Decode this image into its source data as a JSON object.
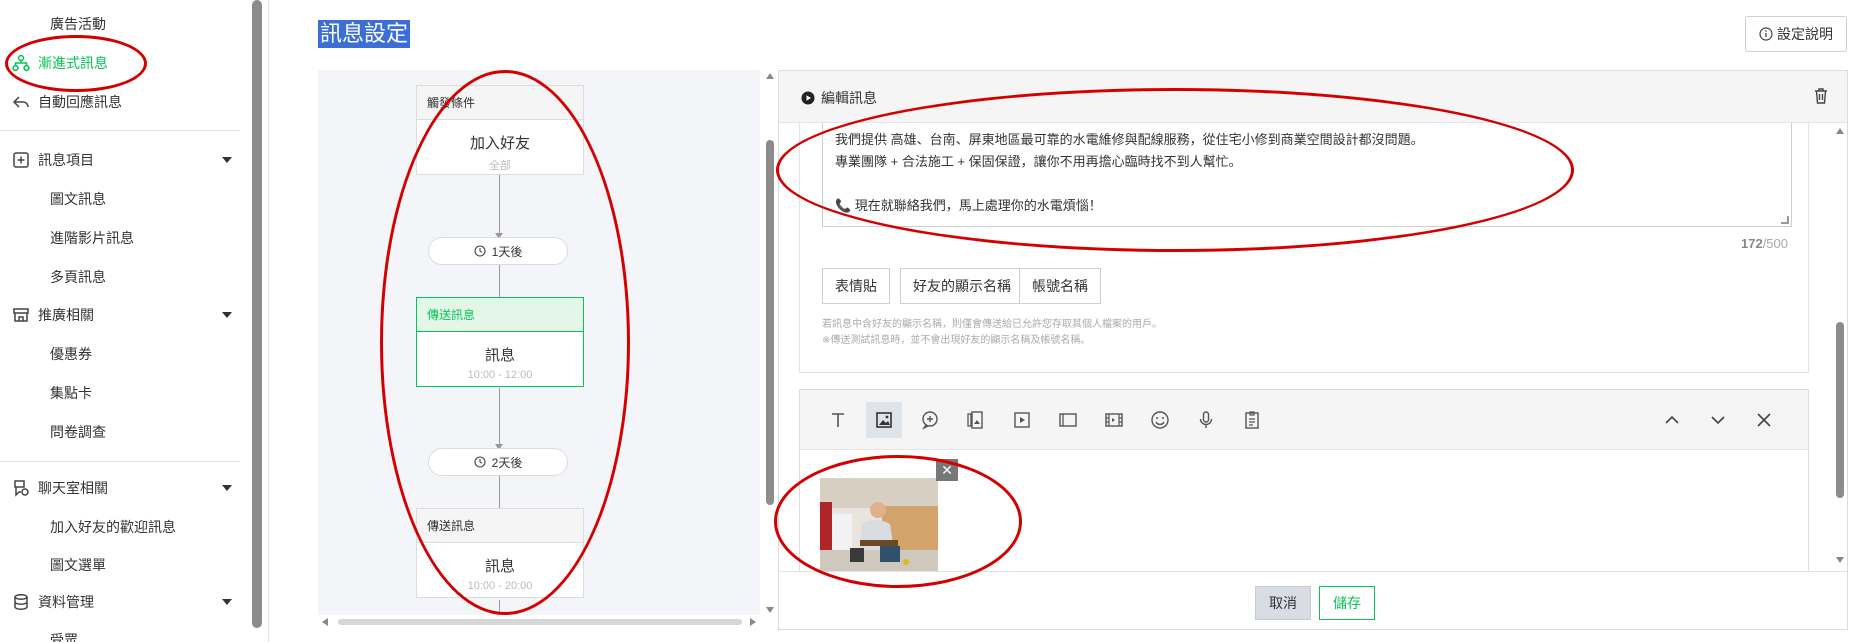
{
  "sidebar": {
    "items": [
      {
        "label": "廣告活動"
      },
      {
        "label": "漸進式訊息"
      },
      {
        "label": "自動回應訊息"
      }
    ],
    "groups": [
      {
        "label": "訊息項目",
        "items": [
          "圖文訊息",
          "進階影片訊息",
          "多頁訊息"
        ]
      },
      {
        "label": "推廣相關",
        "items": [
          "優惠券",
          "集點卡",
          "問卷調查"
        ]
      },
      {
        "label": "聊天室相關",
        "items": [
          "加入好友的歡迎訊息",
          "圖文選單"
        ]
      },
      {
        "label": "資料管理",
        "items": [
          "受眾"
        ]
      }
    ]
  },
  "header": {
    "title": "訊息設定",
    "help_label": "設定說明"
  },
  "flow": {
    "trigger": {
      "header": "觸發條件",
      "title": "加入好友",
      "subtitle": "全部"
    },
    "delay1": "1天後",
    "step1": {
      "header": "傳送訊息",
      "title": "訊息",
      "subtitle": "10:00 - 12:00"
    },
    "delay2": "2天後",
    "step2": {
      "header": "傳送訊息",
      "title": "訊息",
      "subtitle": "10:00 - 20:00"
    }
  },
  "editor": {
    "title": "編輯訊息",
    "message_lines": [
      "我們提供 高雄、台南、屏東地區最可靠的水電維修與配線服務，從住宅小修到商業空間設計都沒問題。",
      "專業團隊 + 合法施工 + 保固保證，讓你不用再擔心臨時找不到人幫忙。",
      "",
      "📞 現在就聯絡我們，馬上處理你的水電煩惱！"
    ],
    "char_count": "172",
    "char_limit": "/500",
    "tag_buttons": [
      "表情貼",
      "好友的顯示名稱",
      "帳號名稱"
    ],
    "notes": [
      "若訊息中含好友的顯示名稱，則僅會傳送給已允許您存取其個人檔案的用戶。",
      "※傳送測試訊息時，並不會出現好友的顯示名稱及帳號名稱。"
    ],
    "toolbar_icons": [
      "text-icon",
      "image-icon",
      "chat-bubble-icon",
      "card-icon",
      "video-icon",
      "rich-message-icon",
      "rich-video-icon",
      "sticker-icon",
      "voice-icon",
      "survey-icon"
    ],
    "cancel_label": "取消",
    "save_label": "儲存"
  },
  "colors": {
    "accent_green": "#06c755",
    "annotation_red": "#d40000",
    "title_highlight": "#3b6fd6"
  }
}
